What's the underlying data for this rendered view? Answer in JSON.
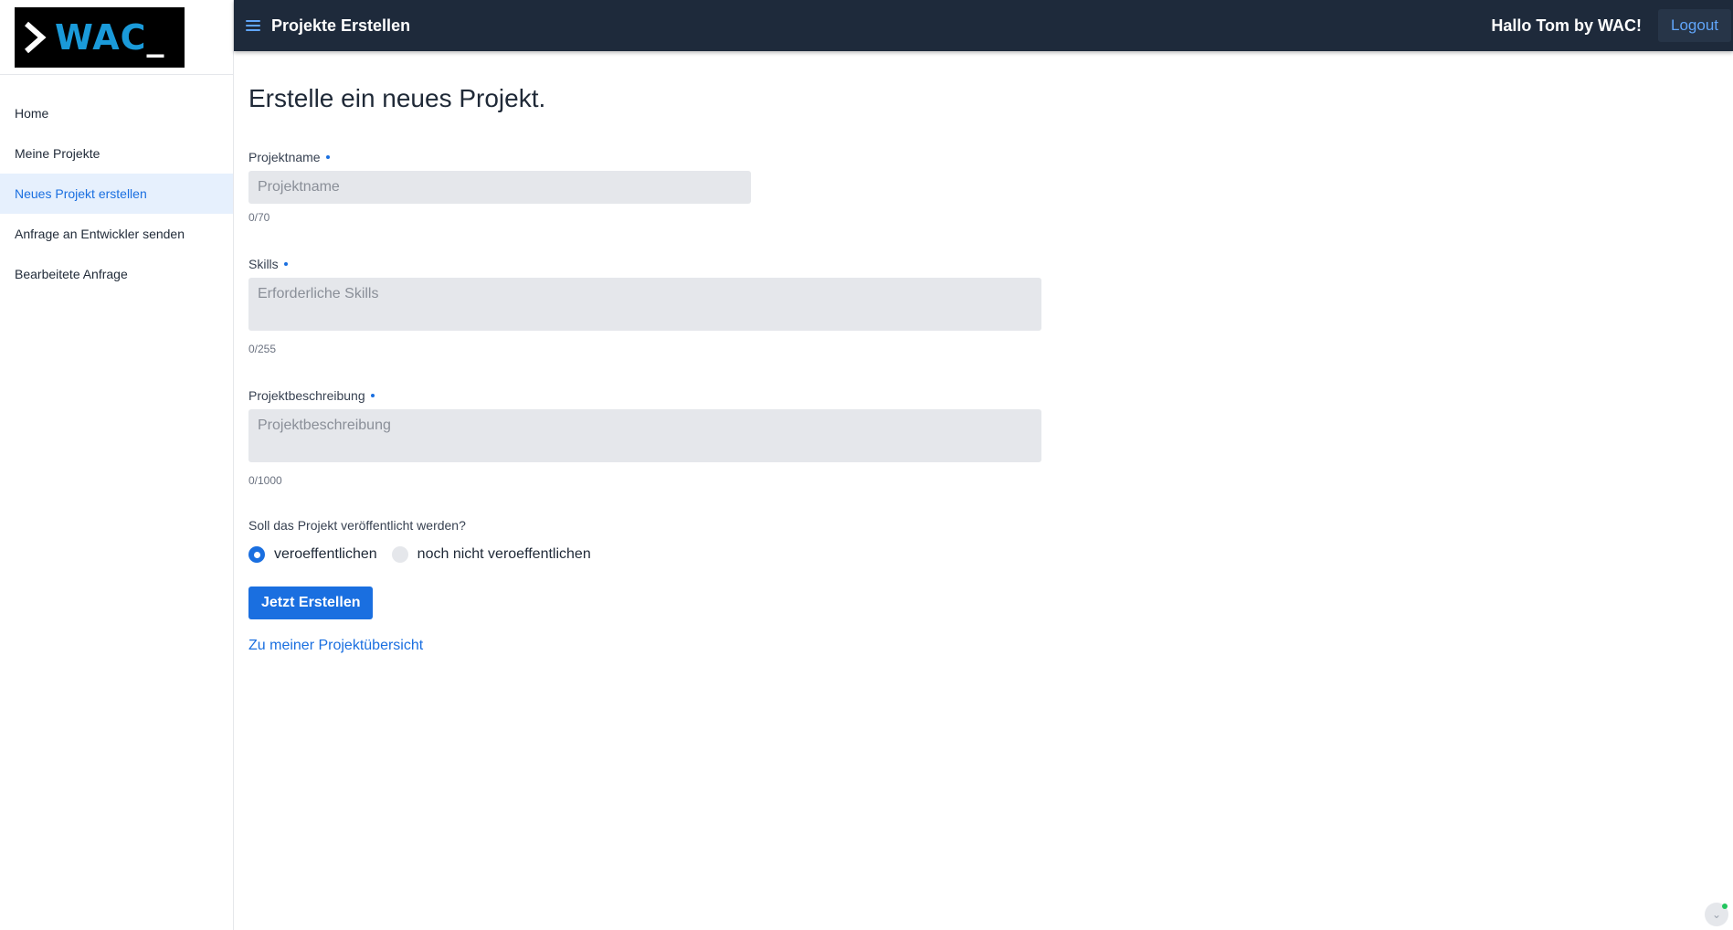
{
  "logo": {
    "text": "WAC",
    "cursor": "_",
    "brand_color": "#1a9ad9"
  },
  "sidebar": {
    "items": [
      {
        "label": "Home",
        "active": false
      },
      {
        "label": "Meine Projekte",
        "active": false
      },
      {
        "label": "Neues Projekt erstellen",
        "active": true
      },
      {
        "label": "Anfrage an Entwickler senden",
        "active": false
      },
      {
        "label": "Bearbeitete Anfrage",
        "active": false
      }
    ]
  },
  "topbar": {
    "title": "Projekte Erstellen",
    "greeting": "Hallo Tom by WAC!",
    "logout_label": "Logout",
    "background": "#1e2a3b"
  },
  "form": {
    "heading": "Erstelle ein neues Projekt.",
    "projectname": {
      "label": "Projektname",
      "placeholder": "Projektname",
      "value": "",
      "counter": "0/70"
    },
    "skills": {
      "label": "Skills",
      "placeholder": "Erforderliche Skills",
      "value": "",
      "counter": "0/255"
    },
    "description": {
      "label": "Projektbeschreibung",
      "placeholder": "Projektbeschreibung",
      "value": "",
      "counter": "0/1000"
    },
    "publish": {
      "question": "Soll das Projekt veröffentlicht werden?",
      "options": [
        {
          "label": "veroeffentlichen",
          "selected": true
        },
        {
          "label": "noch nicht veroeffentlichen",
          "selected": false
        }
      ]
    },
    "submit_label": "Jetzt Erstellen",
    "overview_link": "Zu meiner Projektübersicht"
  },
  "accent_color": "#1a6fe0"
}
